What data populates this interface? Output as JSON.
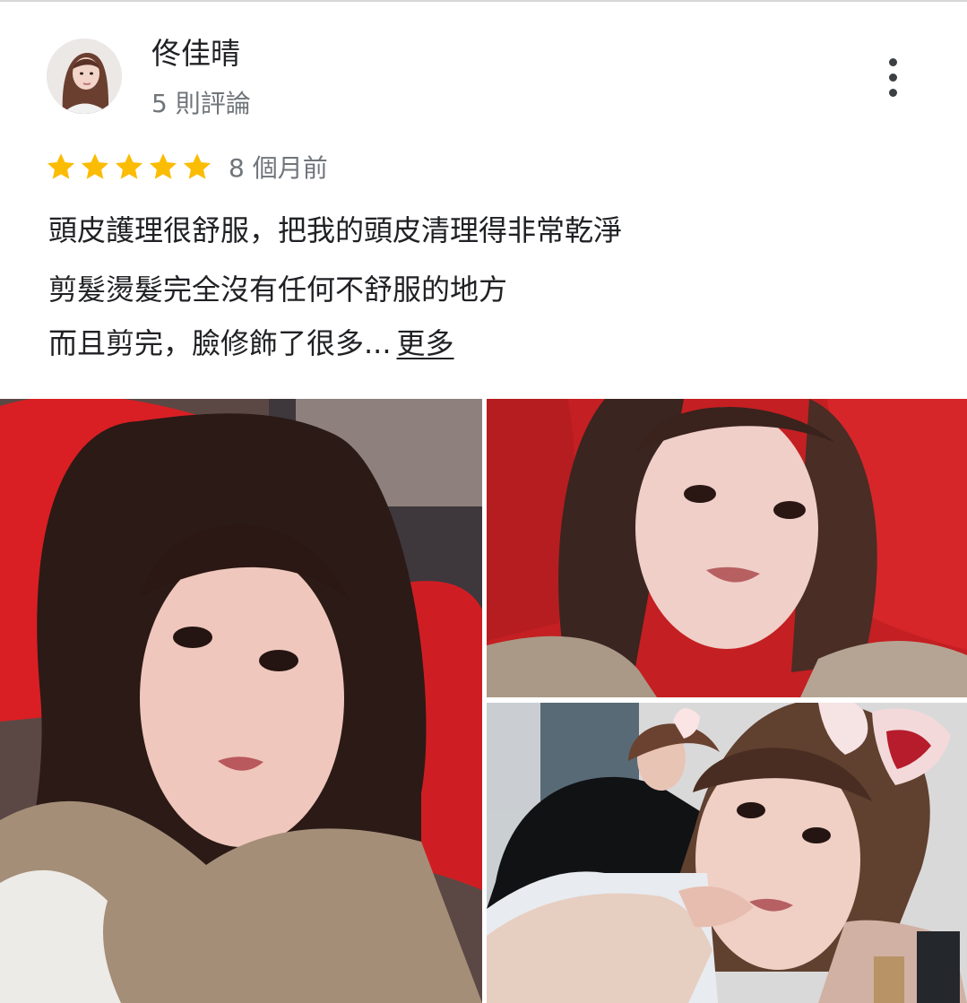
{
  "reviewer": {
    "name": "佟佳晴",
    "review_count": "5 則評論",
    "avatar_icon": "avatar"
  },
  "review": {
    "rating": 5,
    "max_rating": 5,
    "time_ago": "8 個月前",
    "lines": [
      "頭皮護理很舒服，把我的頭皮清理得非常乾淨",
      "剪髮燙髮完全沒有任何不舒服的地方",
      "而且剪完，臉修飾了很多..."
    ],
    "more_label": "更多"
  },
  "menu": {
    "icon": "more-vert-icon"
  },
  "photos": [
    {
      "icon": "review-photo"
    },
    {
      "icon": "review-photo"
    },
    {
      "icon": "review-photo"
    }
  ],
  "colors": {
    "star": "#fbbc04",
    "text_primary": "#202124",
    "text_secondary": "#70757a"
  }
}
